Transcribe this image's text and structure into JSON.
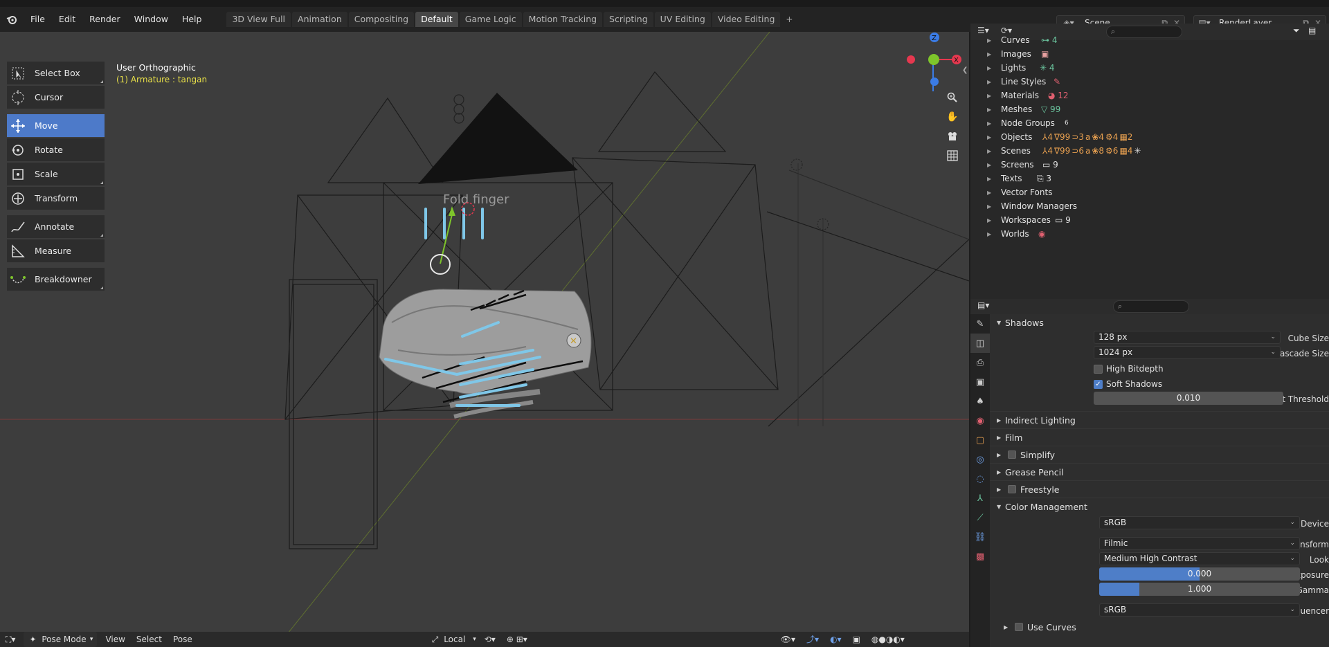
{
  "topbar": {
    "menu": [
      "File",
      "Edit",
      "Render",
      "Window",
      "Help"
    ],
    "workspaces": [
      "3D View Full",
      "Animation",
      "Compositing",
      "Default",
      "Game Logic",
      "Motion Tracking",
      "Scripting",
      "UV Editing",
      "Video Editing"
    ],
    "active_workspace": "Default",
    "add_workspace": "+",
    "scene": "Scene",
    "render_layer": "RenderLayer"
  },
  "toolbar": {
    "tools": [
      {
        "label": "Select Box",
        "icon": "select-box-icon"
      },
      {
        "label": "Cursor",
        "icon": "cursor-icon"
      },
      {
        "label": "Move",
        "icon": "move-icon",
        "active": true
      },
      {
        "label": "Rotate",
        "icon": "rotate-icon"
      },
      {
        "label": "Scale",
        "icon": "scale-icon"
      },
      {
        "label": "Transform",
        "icon": "transform-icon"
      },
      {
        "label": "Annotate",
        "icon": "annotate-icon"
      },
      {
        "label": "Measure",
        "icon": "measure-icon"
      },
      {
        "label": "Breakdowner",
        "icon": "breakdowner-icon"
      }
    ]
  },
  "viewport": {
    "title": "User Orthographic",
    "subtitle": "(1) Armature : tangan",
    "overlay_text": "Fold finger",
    "gizmo_axes": {
      "z": "Z",
      "x": "X"
    },
    "colors": {
      "x": "#e6384f",
      "y": "#7ec52b",
      "z": "#3b7ce6",
      "bone": "#7fc7e8",
      "accent": "#4d7ac9"
    }
  },
  "bottombar": {
    "mode": "Pose Mode",
    "menus": [
      "View",
      "Select",
      "Pose"
    ],
    "pivot": "Local"
  },
  "outliner": {
    "items": [
      {
        "label": "Curves",
        "chips": [
          "⊶ 4"
        ]
      },
      {
        "label": "Images",
        "chips": [
          "▣"
        ]
      },
      {
        "label": "Lights",
        "chips": [
          "✳ 4"
        ]
      },
      {
        "label": "Line Styles",
        "chips": [
          "✎"
        ]
      },
      {
        "label": "Materials",
        "chips": [
          "◕ 12"
        ]
      },
      {
        "label": "Meshes",
        "chips": [
          "▽ 99"
        ]
      },
      {
        "label": "Node Groups",
        "chips": [
          "6"
        ]
      },
      {
        "label": "Objects",
        "chips": [
          "⅄4",
          "∇99",
          "⊃3",
          "a",
          "❀4",
          "⚙4",
          "▦2"
        ]
      },
      {
        "label": "Scenes",
        "chips": [
          "⅄4",
          "∇99",
          "⊃6",
          "a",
          "❀8",
          "⚙6",
          "▦4",
          "✳"
        ]
      },
      {
        "label": "Screens",
        "chips": [
          "▭ 9"
        ]
      },
      {
        "label": "Texts",
        "chips": [
          "⎘ 3"
        ]
      },
      {
        "label": "Vector Fonts",
        "chips": []
      },
      {
        "label": "Window Managers",
        "chips": []
      },
      {
        "label": "Workspaces",
        "chips": [
          "▭ 9"
        ]
      },
      {
        "label": "Worlds",
        "chips": [
          "◉"
        ]
      }
    ]
  },
  "properties": {
    "shadows": {
      "title": "Shadows",
      "cube_size_label": "Cube Size",
      "cube_size": "128 px",
      "cascade_size_label": "Cascade Size",
      "cascade_size": "1024 px",
      "high_bitdepth": "High Bitdepth",
      "high_bitdepth_checked": false,
      "soft_shadows": "Soft Shadows",
      "soft_shadows_checked": true,
      "light_threshold_label": "Light Threshold",
      "light_threshold": "0.010"
    },
    "panels": [
      "Indirect Lighting",
      "Film",
      "Simplify",
      "Grease Pencil",
      "Freestyle"
    ],
    "color_management": {
      "title": "Color Management",
      "display_device_label": "Display Device",
      "display_device": "sRGB",
      "view_transform_label": "View Transform",
      "view_transform": "Filmic",
      "look_label": "Look",
      "look": "Medium High Contrast",
      "exposure_label": "Exposure",
      "exposure": "0.000",
      "exposure_fill": 0.5,
      "gamma_label": "Gamma",
      "gamma": "1.000",
      "gamma_fill": 0.2,
      "sequencer_label": "Sequencer",
      "sequencer": "sRGB",
      "use_curves": "Use Curves"
    }
  }
}
